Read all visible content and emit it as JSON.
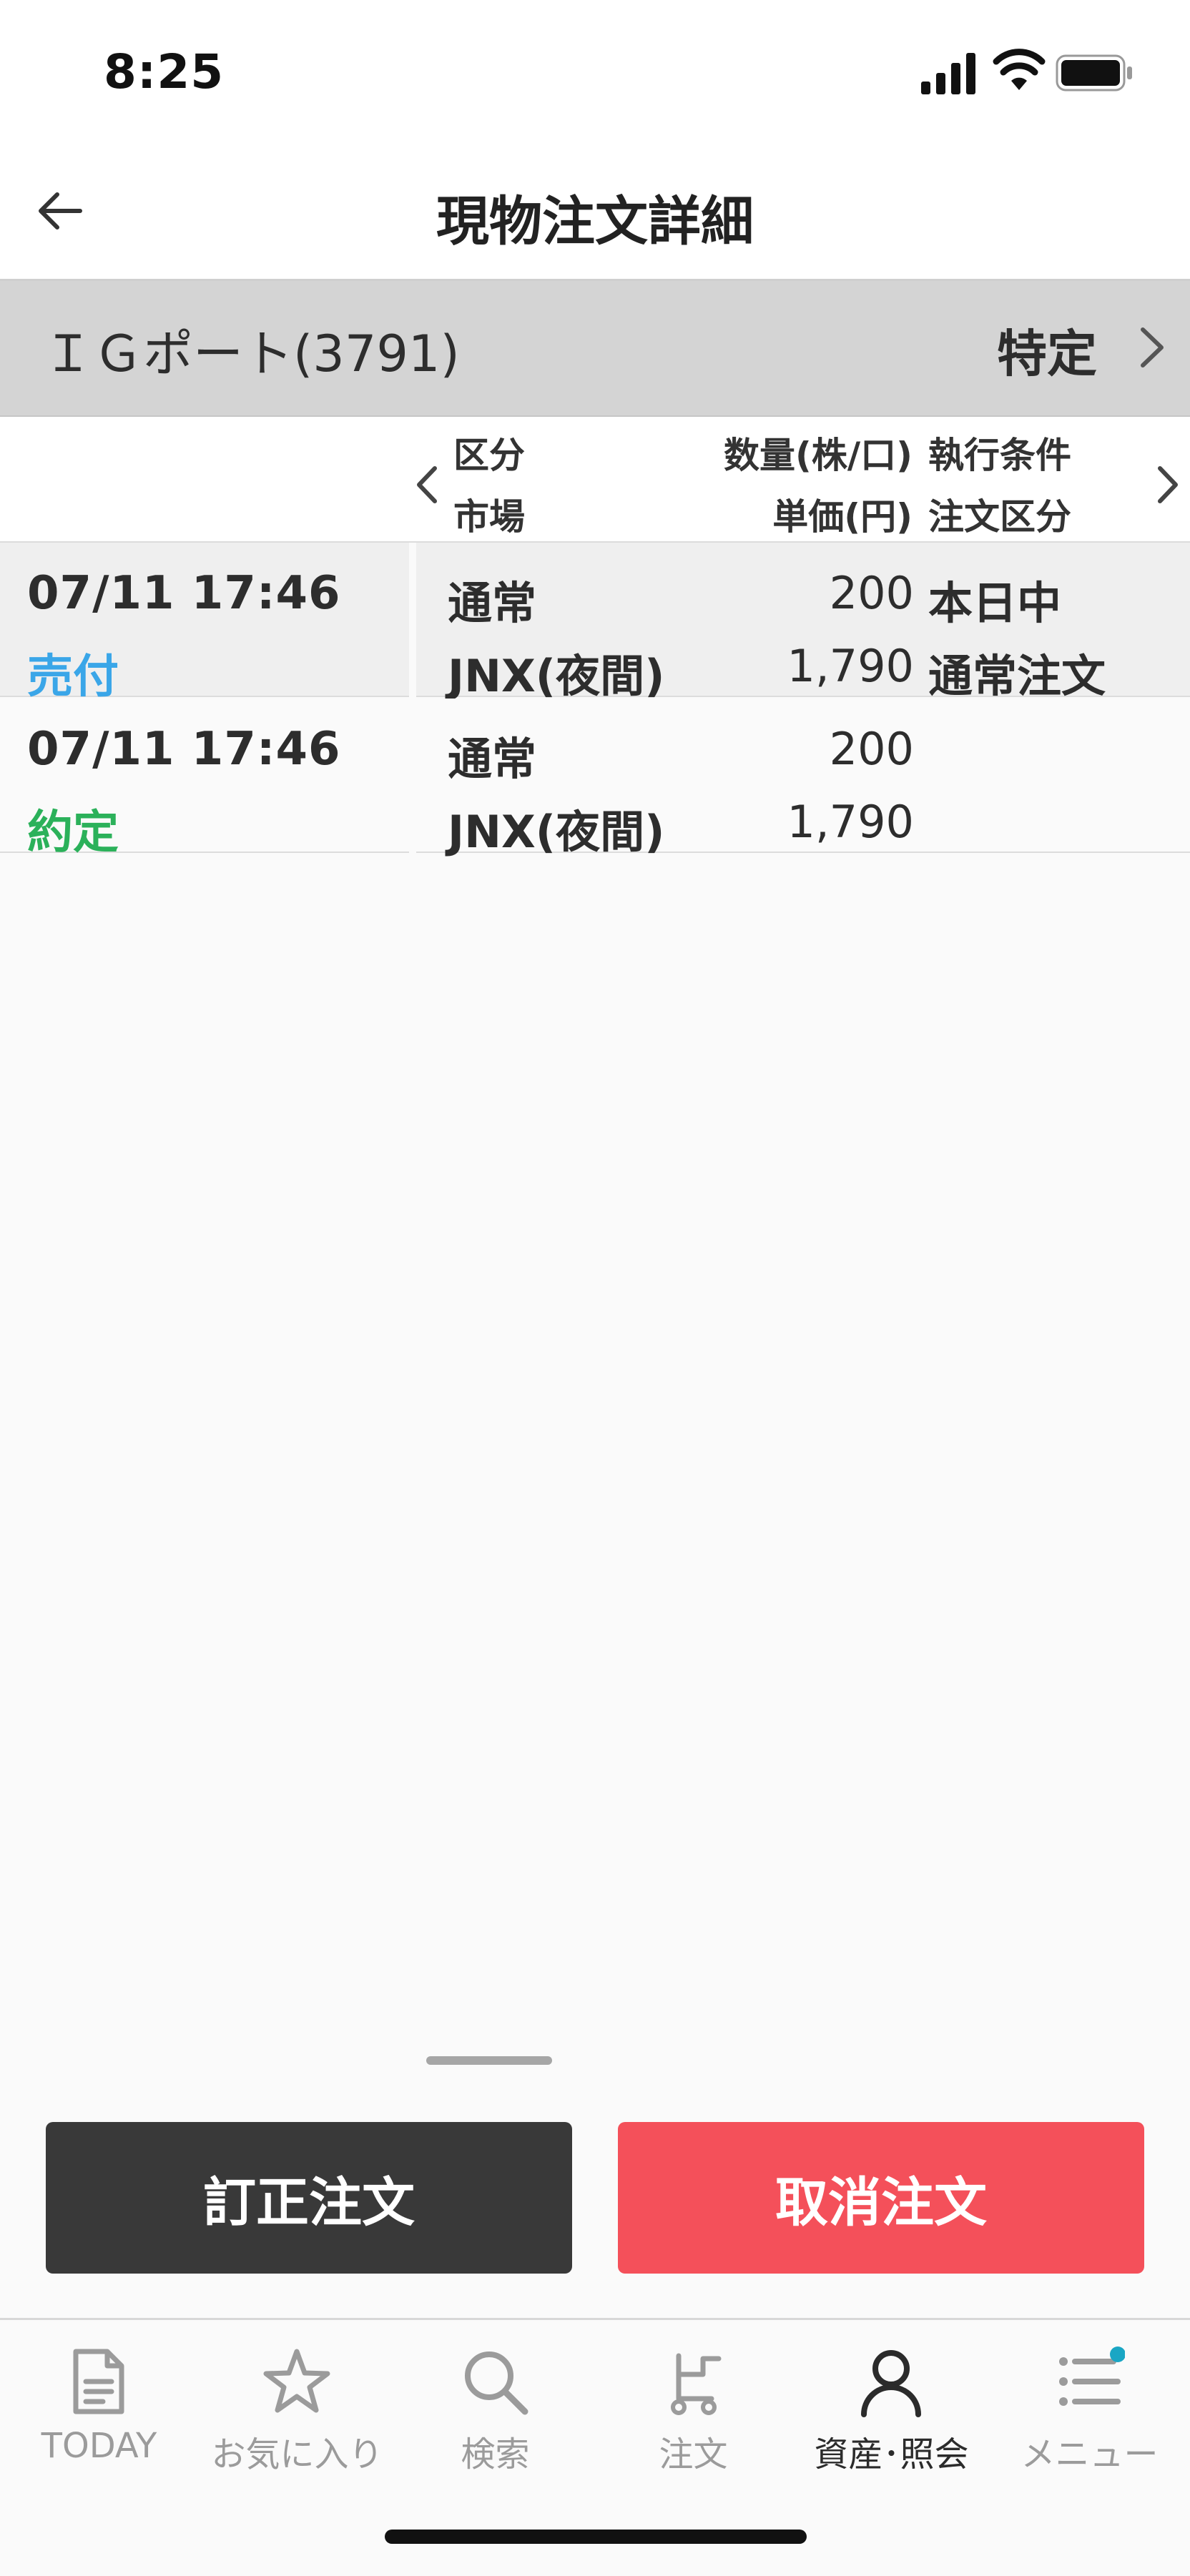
{
  "status": {
    "time": "8:25"
  },
  "header": {
    "title": "現物注文詳細"
  },
  "stock": {
    "name": "ＩＧポート(3791)",
    "account_type": "特定"
  },
  "columns": {
    "type_label": "区分",
    "market_label": "市場",
    "qty_label": "数量(株/口)",
    "price_label": "単価(円)",
    "cond_label": "執行条件",
    "order_type_label": "注文区分"
  },
  "rows": [
    {
      "datetime": "07/11 17:46",
      "status": "売付",
      "type": "通常",
      "market": "JNX(夜間)",
      "qty": "200",
      "price": "1,790",
      "condition": "本日中",
      "order_type": "通常注文",
      "status_color": "#3aa6e8"
    },
    {
      "datetime": "07/11 17:46",
      "status": "約定",
      "type": "通常",
      "market": "JNX(夜間)",
      "qty": "200",
      "price": "1,790",
      "condition": "",
      "order_type": "",
      "status_color": "#2bb15a"
    }
  ],
  "actions": {
    "edit_label": "訂正注文",
    "cancel_label": "取消注文"
  },
  "tabbar": {
    "items": [
      {
        "label": "TODAY",
        "icon": "document-icon"
      },
      {
        "label": "お気に入り",
        "icon": "star-icon"
      },
      {
        "label": "検索",
        "icon": "search-icon"
      },
      {
        "label": "注文",
        "icon": "cart-icon"
      },
      {
        "label": "資産･照会",
        "icon": "person-icon",
        "active": true
      },
      {
        "label": "メニュー",
        "icon": "menu-list-icon"
      }
    ],
    "badge_color": "#1aa6c4"
  },
  "colors": {
    "sell": "#3aa6e8",
    "executed": "#2bb15a",
    "cancel_button": "#f4505a",
    "edit_button": "#393939"
  }
}
